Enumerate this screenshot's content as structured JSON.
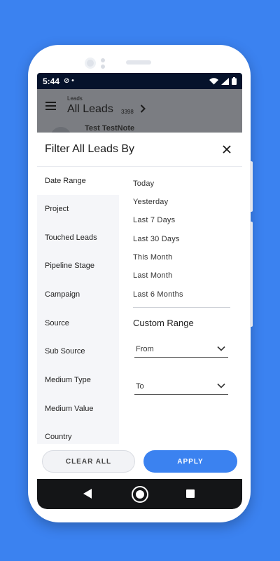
{
  "status_bar": {
    "time": "5:44",
    "extra": "⊘ •"
  },
  "app_bar": {
    "breadcrumb": "Leads",
    "title": "All Leads",
    "count": "3398",
    "behind_name": "Test TestNote"
  },
  "sheet": {
    "title": "Filter All Leads By",
    "categories": [
      {
        "label": "Date Range"
      },
      {
        "label": "Project"
      },
      {
        "label": "Touched Leads"
      },
      {
        "label": "Pipeline Stage"
      },
      {
        "label": "Campaign"
      },
      {
        "label": "Source"
      },
      {
        "label": "Sub Source"
      },
      {
        "label": "Medium Type"
      },
      {
        "label": "Medium Value"
      },
      {
        "label": "Country"
      }
    ],
    "date_options": [
      {
        "label": "Today"
      },
      {
        "label": "Yesterday"
      },
      {
        "label": "Last 7 Days"
      },
      {
        "label": "Last 30 Days"
      },
      {
        "label": "This Month"
      },
      {
        "label": "Last Month"
      },
      {
        "label": "Last 6 Months"
      }
    ],
    "custom_range_label": "Custom Range",
    "from_label": "From",
    "to_label": "To"
  },
  "footer": {
    "clear_label": "CLEAR ALL",
    "apply_label": "APPLY"
  },
  "colors": {
    "accent": "#3b82f0",
    "statusbar": "#06122b",
    "navbar": "#141517"
  },
  "icons": {
    "menu": "hamburger-icon",
    "close": "close-icon",
    "chevron": "chevron-down-icon",
    "wifi": "wifi-icon",
    "signal": "signal-icon",
    "battery": "battery-icon"
  }
}
